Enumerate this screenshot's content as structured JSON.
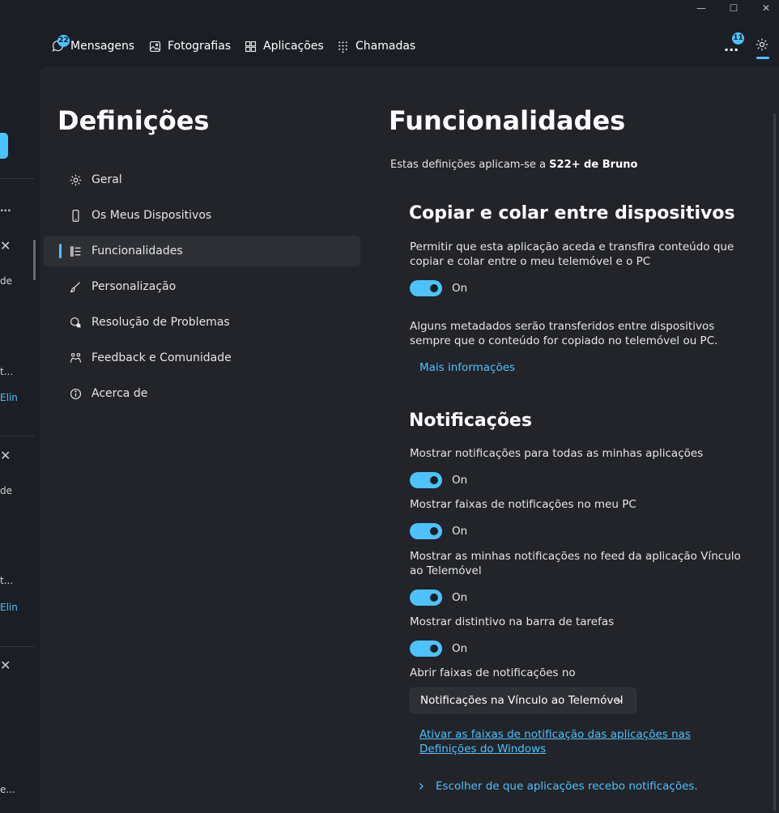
{
  "window": {
    "controls": [
      "—",
      "☐",
      "✕"
    ]
  },
  "nav": {
    "tabs": [
      {
        "label": "Mensagens",
        "badge": "22"
      },
      {
        "label": "Fotografias"
      },
      {
        "label": "Aplicações"
      },
      {
        "label": "Chamadas"
      }
    ],
    "more_label": "...",
    "more_badge": "11"
  },
  "left_strip": {
    "dots": "...",
    "snippet_de": "de",
    "snippet_t": "t...",
    "snippet_elin": "Elin",
    "snippet_e": "e..."
  },
  "sidebar": {
    "title": "Definições",
    "items": [
      {
        "label": "Geral",
        "icon": "gear-icon"
      },
      {
        "label": "Os Meus Dispositivos",
        "icon": "phone-icon"
      },
      {
        "label": "Funcionalidades",
        "icon": "features-list-icon",
        "active": true
      },
      {
        "label": "Personalização",
        "icon": "brush-icon"
      },
      {
        "label": "Resolução de Problemas",
        "icon": "troubleshoot-icon"
      },
      {
        "label": "Feedback e Comunidade",
        "icon": "feedback-icon"
      },
      {
        "label": "Acerca de",
        "icon": "info-icon"
      }
    ]
  },
  "main": {
    "title": "Funcionalidades",
    "applies_prefix": "Estas definições aplicam-se a ",
    "device_name": "S22+ de Bruno",
    "copy_section": {
      "title": "Copiar e colar entre dispositivos",
      "description": "Permitir que esta aplicação aceda e transfira conteúdo que copiar e colar entre o meu telemóvel e o PC",
      "toggle_state": "On",
      "note": "Alguns metadados serão transferidos entre dispositivos sempre que o conteúdo for copiado no telemóvel ou PC.",
      "more_info": "Mais informações"
    },
    "notif_section": {
      "title": "Notificações",
      "settings": [
        {
          "label": "Mostrar notificações para todas as minhas aplicações",
          "state": "On"
        },
        {
          "label": "Mostrar faixas de notificações no meu PC",
          "state": "On"
        },
        {
          "label": "Mostrar as minhas notificações no feed da aplicação Vínculo ao Telemóvel",
          "state": "On"
        },
        {
          "label": "Mostrar distintivo na barra de tarefas",
          "state": "On"
        }
      ],
      "open_banners_label": "Abrir faixas de notificações no",
      "open_banners_value": "Notificações na Vínculo ao Telemóvel",
      "windows_link": "Ativar as faixas de notificação das aplicações nas Definições do Windows",
      "choose_apps": "Escolher de que aplicações recebo notificações."
    }
  },
  "colors": {
    "accent": "#4cc2ff",
    "panel": "#222429",
    "background": "#1b1e24"
  }
}
